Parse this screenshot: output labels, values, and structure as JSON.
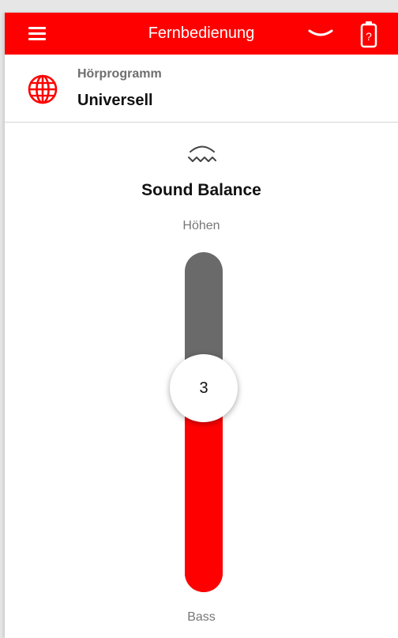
{
  "header": {
    "title": "Fernbedienung",
    "menu_icon": "hamburger-menu-icon",
    "chevron_icon": "chevron-down-icon",
    "battery_icon": "battery-unknown-icon",
    "background_color": "#ff0000"
  },
  "program": {
    "label": "Hörprogramm",
    "value": "Universell",
    "icon": "globe-icon",
    "icon_color": "#ff0000"
  },
  "sound_balance": {
    "icon": "sound-balance-waves-icon",
    "title": "Sound Balance",
    "top_label": "Höhen",
    "bottom_label": "Bass",
    "value": "3",
    "fill_fraction": 0.6,
    "fill_color": "#ff0000",
    "track_color": "#6a6a6a"
  }
}
